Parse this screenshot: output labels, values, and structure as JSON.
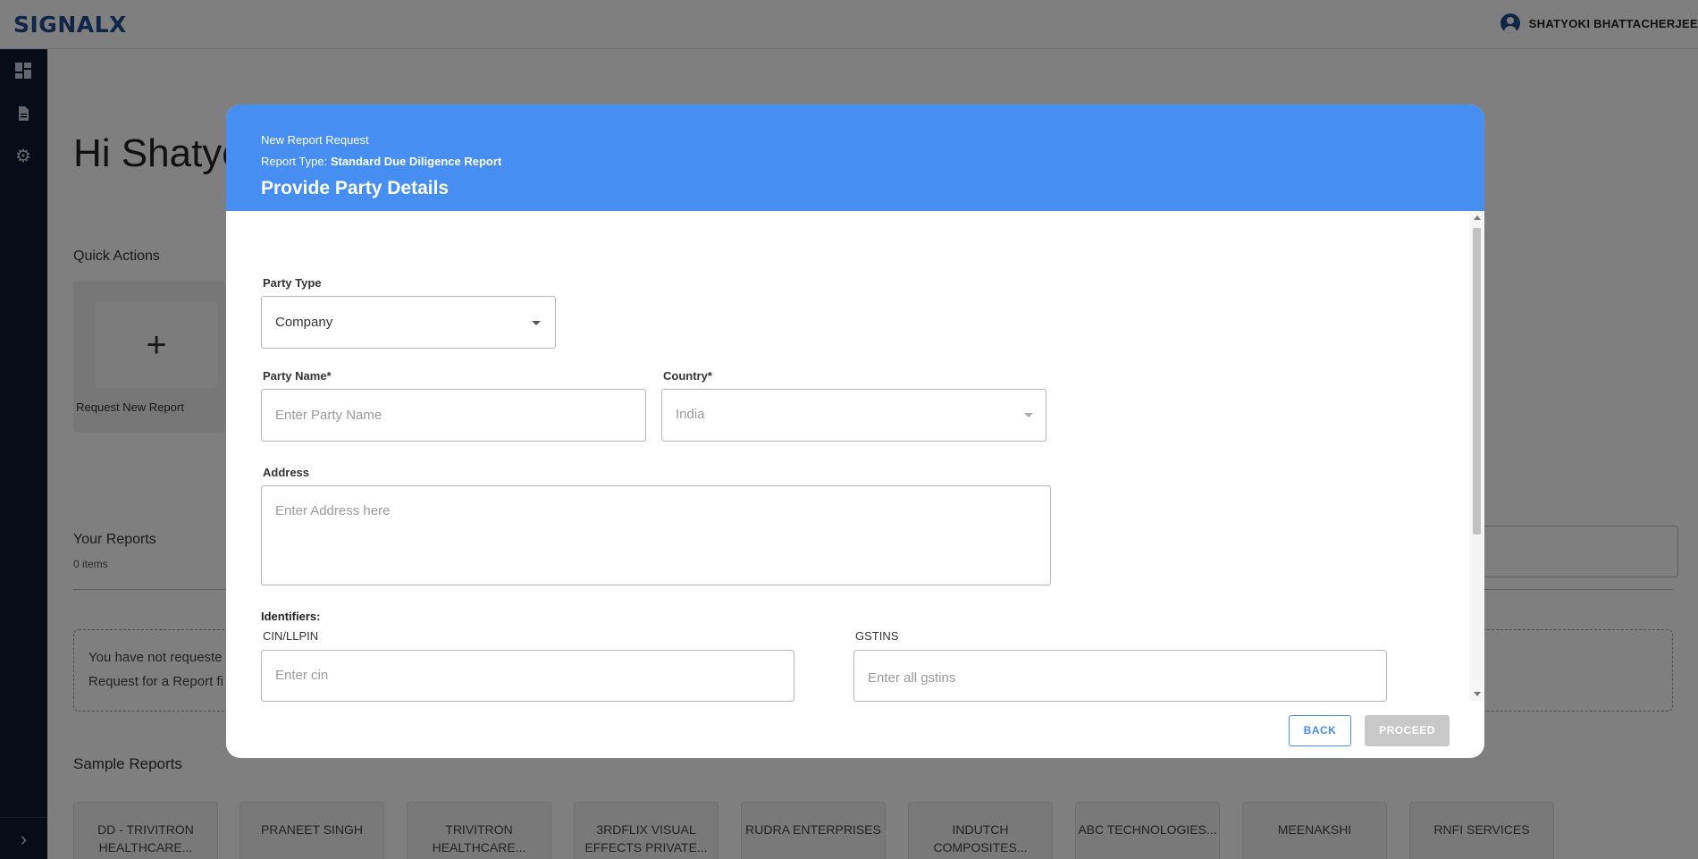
{
  "app": {
    "logo": "SIGNALX",
    "user_name": "SHATYOKI BHATTACHERJEE"
  },
  "main": {
    "greeting": "Hi Shatyo",
    "quick_actions_label": "Quick Actions",
    "request_new_report": "Request New Report",
    "plus": "+",
    "your_reports_label": "Your Reports",
    "your_reports_count": "0 items",
    "empty_line1": "You have not requeste",
    "empty_line2": "Request for a Report fi",
    "sample_reports_label": "Sample Reports",
    "sample_reports": [
      "DD - TRIVITRON HEALTHCARE...",
      "PRANEET SINGH",
      "TRIVITRON HEALTHCARE...",
      "3RDFLIX VISUAL EFFECTS PRIVATE...",
      "RUDRA ENTERPRISES",
      "INDUTCH COMPOSITES...",
      "ABC TECHNOLOGIES...",
      "MEENAKSHI",
      "RNFI SERVICES"
    ]
  },
  "modal": {
    "subtitle": "New Report Request",
    "report_type_label": "Report Type: ",
    "report_type_value": "Standard Due Diligence Report",
    "title": "Provide Party Details",
    "party_type_label": "Party Type",
    "party_type_value": "Company",
    "party_name_label": "Party Name*",
    "party_name_placeholder": "Enter Party Name",
    "country_label": "Country*",
    "country_value": "India",
    "address_label": "Address",
    "address_placeholder": "Enter Address here",
    "identifiers_label": "Identifiers:",
    "cin_label": "CIN/LLPIN",
    "cin_placeholder": "Enter cin",
    "gstins_label": "GSTINS",
    "gstins_placeholder": "Enter all gstins",
    "back_label": "BACK",
    "proceed_label": "PROCEED"
  },
  "colors": {
    "header_blue": "#468ef1",
    "sidebar": "#0e1a30",
    "logo": "#1e4d8c",
    "proceed_disabled": "#c8c8c8"
  },
  "icons": [
    "user-avatar-icon",
    "dashboard-icon",
    "document-icon",
    "gear-icon",
    "chevron-right-icon",
    "dropdown-caret-icon"
  ]
}
